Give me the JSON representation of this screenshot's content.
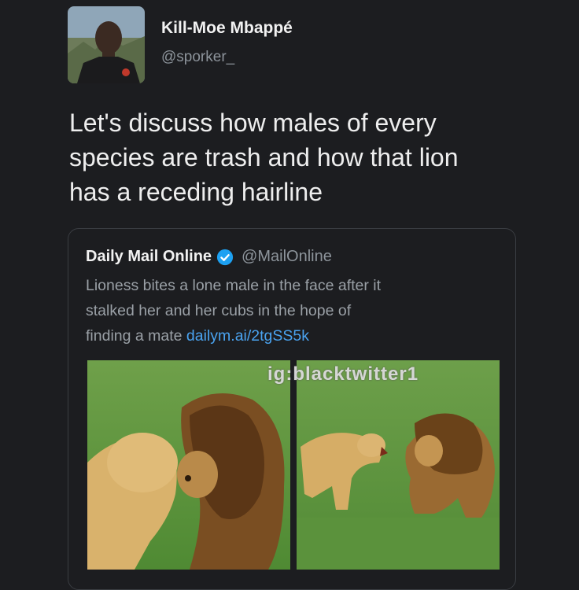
{
  "user": {
    "display_name": "Kill-Moe Mbappé",
    "handle": "@sporker_"
  },
  "tweet": {
    "text_lines": [
      "Let's discuss how males of every",
      "species are trash and how that lion",
      "has a receding hairline"
    ]
  },
  "quoted_tweet": {
    "display_name": "Daily Mail Online",
    "handle": "@MailOnline",
    "verified_icon": "verified-badge-icon",
    "text_lines": [
      "Lioness bites a lone male in the face after it",
      "stalked her and her cubs in the hope of",
      "finding a mate "
    ],
    "link": "dailym.ai/2tgSS5k"
  },
  "watermark": "ig:blacktwitter1",
  "colors": {
    "background": "#1c1d20",
    "link": "#4aa3f0",
    "verified": "#1da1f2",
    "muted": "#8d949b"
  }
}
